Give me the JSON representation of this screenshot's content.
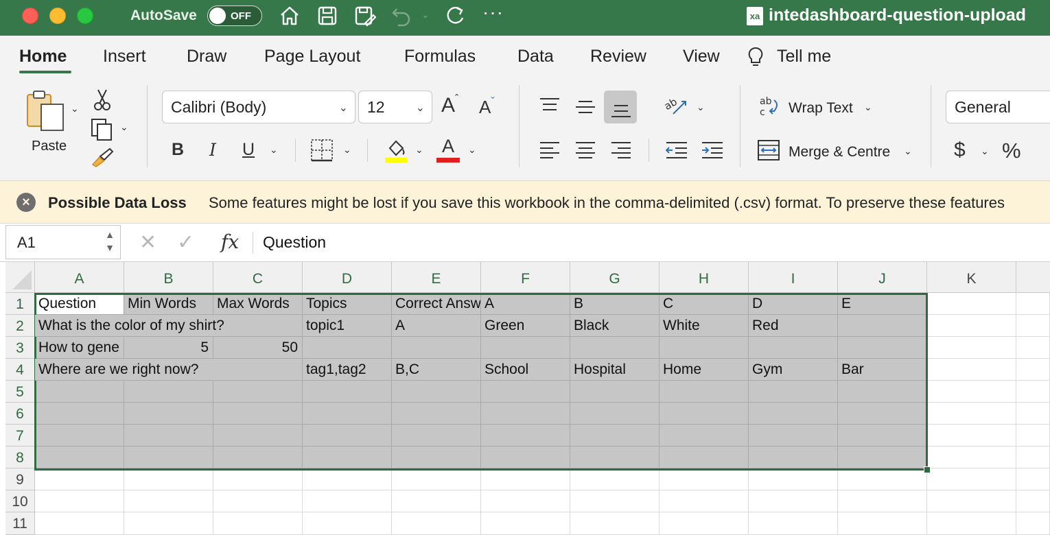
{
  "titlebar": {
    "autosave_label": "AutoSave",
    "autosave_state": "OFF",
    "more_label": "···",
    "doc_icon_text": "xa",
    "doc_title": "intedashboard-question-upload"
  },
  "tabs": [
    {
      "label": "Home",
      "active": true
    },
    {
      "label": "Insert"
    },
    {
      "label": "Draw"
    },
    {
      "label": "Page Layout"
    },
    {
      "label": "Formulas"
    },
    {
      "label": "Data"
    },
    {
      "label": "Review"
    },
    {
      "label": "View"
    },
    {
      "label": "Tell me"
    }
  ],
  "ribbon": {
    "paste_label": "Paste",
    "font_name": "Calibri (Body)",
    "font_size": "12",
    "bold": "B",
    "italic": "I",
    "underline": "U",
    "grow_font": "A",
    "shrink_font": "A",
    "font_color_glyph": "A",
    "wrap_text_label": "Wrap Text",
    "merge_label": "Merge & Centre",
    "number_format": "General",
    "currency": "$",
    "percent": "%",
    "highlight_color": "#ffff00",
    "font_color": "#e02020"
  },
  "message": {
    "icon": "×",
    "title": "Possible Data Loss",
    "text": "Some features might be lost if you save this workbook in the comma-delimited (.csv) format. To preserve these features"
  },
  "formula_bar": {
    "name_box": "A1",
    "cancel_glyph": "✕",
    "enter_glyph": "✓",
    "fx_label": "fx",
    "formula": "Question"
  },
  "columns": [
    "A",
    "B",
    "C",
    "D",
    "E",
    "F",
    "G",
    "H",
    "I",
    "J",
    "K"
  ],
  "rows": [
    "1",
    "2",
    "3",
    "4",
    "5",
    "6",
    "7",
    "8",
    "9",
    "10",
    "11"
  ],
  "cells": {
    "r1": [
      "Question",
      "Min Words",
      "Max Words",
      "Topics",
      "Correct Answ",
      "A",
      "B",
      "C",
      "D",
      "E"
    ],
    "r2": [
      "What is the color of my shirt?",
      "",
      "",
      "topic1",
      "A",
      "Green",
      "Black",
      "White",
      "Red",
      ""
    ],
    "r3": [
      "How to gene",
      "5",
      "50",
      "",
      "",
      "",
      "",
      "",
      "",
      ""
    ],
    "r4": [
      "Where are we right now?",
      "",
      "",
      "tag1,tag2",
      "B,C",
      "School",
      "Hospital",
      "Home",
      "Gym",
      "Bar"
    ]
  },
  "colors": {
    "title_green": "#37784a",
    "selection_gray": "#c6c6c6",
    "warning_bg": "#fdf3d9"
  }
}
